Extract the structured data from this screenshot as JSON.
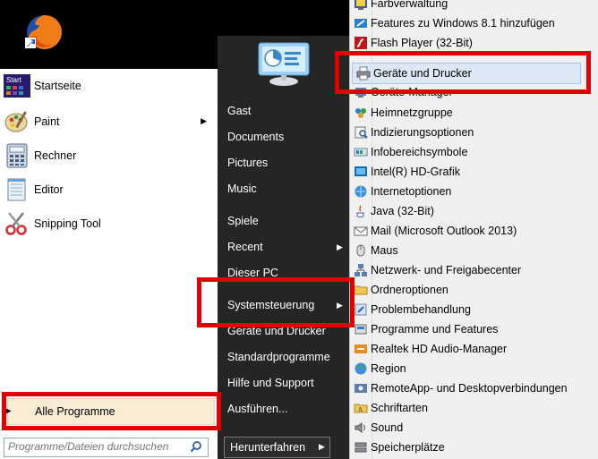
{
  "left": {
    "programs": [
      {
        "label": "Startseite",
        "icon": "start-tile-icon",
        "arrow": false
      },
      {
        "label": "Paint",
        "icon": "paint-palette-icon",
        "arrow": true
      },
      {
        "label": "Rechner",
        "icon": "calculator-icon",
        "arrow": false
      },
      {
        "label": "Editor",
        "icon": "notepad-icon",
        "arrow": false
      },
      {
        "label": "Snipping Tool",
        "icon": "scissors-icon",
        "arrow": false
      }
    ],
    "start_tile_text": "Start",
    "all_programs": "Alle Programme",
    "search_placeholder": "Programme/Dateien durchsuchen"
  },
  "middle": {
    "items": [
      {
        "label": "Gast"
      },
      {
        "label": "Documents"
      },
      {
        "label": "Pictures"
      },
      {
        "label": "Music"
      },
      {
        "label": "Spiele"
      },
      {
        "label": "Recent"
      },
      {
        "label": "Dieser PC"
      },
      {
        "label": "Systemsteuerung"
      },
      {
        "label": "Geräte und Drucker"
      },
      {
        "label": "Standardprogramme"
      },
      {
        "label": "Hilfe und Support"
      },
      {
        "label": "Ausführen..."
      }
    ],
    "shutdown": "Herunterfahren"
  },
  "submenu": {
    "items": [
      {
        "label": "Farbverwaltung",
        "icon": "color-management-icon"
      },
      {
        "label": "Features zu Windows 8.1 hinzufügen",
        "icon": "windows-features-icon"
      },
      {
        "label": "Flash Player (32-Bit)",
        "icon": "flash-player-icon"
      },
      {
        "label": "Geräte und Drucker",
        "icon": "printer-icon"
      },
      {
        "label": "Geräte-Manager",
        "icon": "device-manager-icon"
      },
      {
        "label": "Heimnetzgruppe",
        "icon": "homegroup-icon"
      },
      {
        "label": "Indizierungsoptionen",
        "icon": "indexing-icon"
      },
      {
        "label": "Infobereichsymbole",
        "icon": "notification-area-icon"
      },
      {
        "label": "Intel(R) HD-Grafik",
        "icon": "intel-graphics-icon"
      },
      {
        "label": "Internetoptionen",
        "icon": "internet-options-icon"
      },
      {
        "label": "Java (32-Bit)",
        "icon": "java-icon"
      },
      {
        "label": "Mail (Microsoft Outlook 2013)",
        "icon": "mail-icon"
      },
      {
        "label": "Maus",
        "icon": "mouse-icon"
      },
      {
        "label": "Netzwerk- und Freigabecenter",
        "icon": "network-icon"
      },
      {
        "label": "Ordneroptionen",
        "icon": "folder-options-icon"
      },
      {
        "label": "Problembehandlung",
        "icon": "troubleshooting-icon"
      },
      {
        "label": "Programme und Features",
        "icon": "programs-features-icon"
      },
      {
        "label": "Realtek HD Audio-Manager",
        "icon": "realtek-audio-icon"
      },
      {
        "label": "Region",
        "icon": "region-icon"
      },
      {
        "label": "RemoteApp- und Desktopverbindungen",
        "icon": "remoteapp-icon"
      },
      {
        "label": "Schriftarten",
        "icon": "fonts-icon"
      },
      {
        "label": "Sound",
        "icon": "sound-icon"
      },
      {
        "label": "Speicherplätze",
        "icon": "storage-spaces-icon"
      }
    ]
  },
  "colors": {
    "highlight": "#e00000",
    "menu_dark": "#252525",
    "all_programs_bg": "#f9ecd4"
  }
}
